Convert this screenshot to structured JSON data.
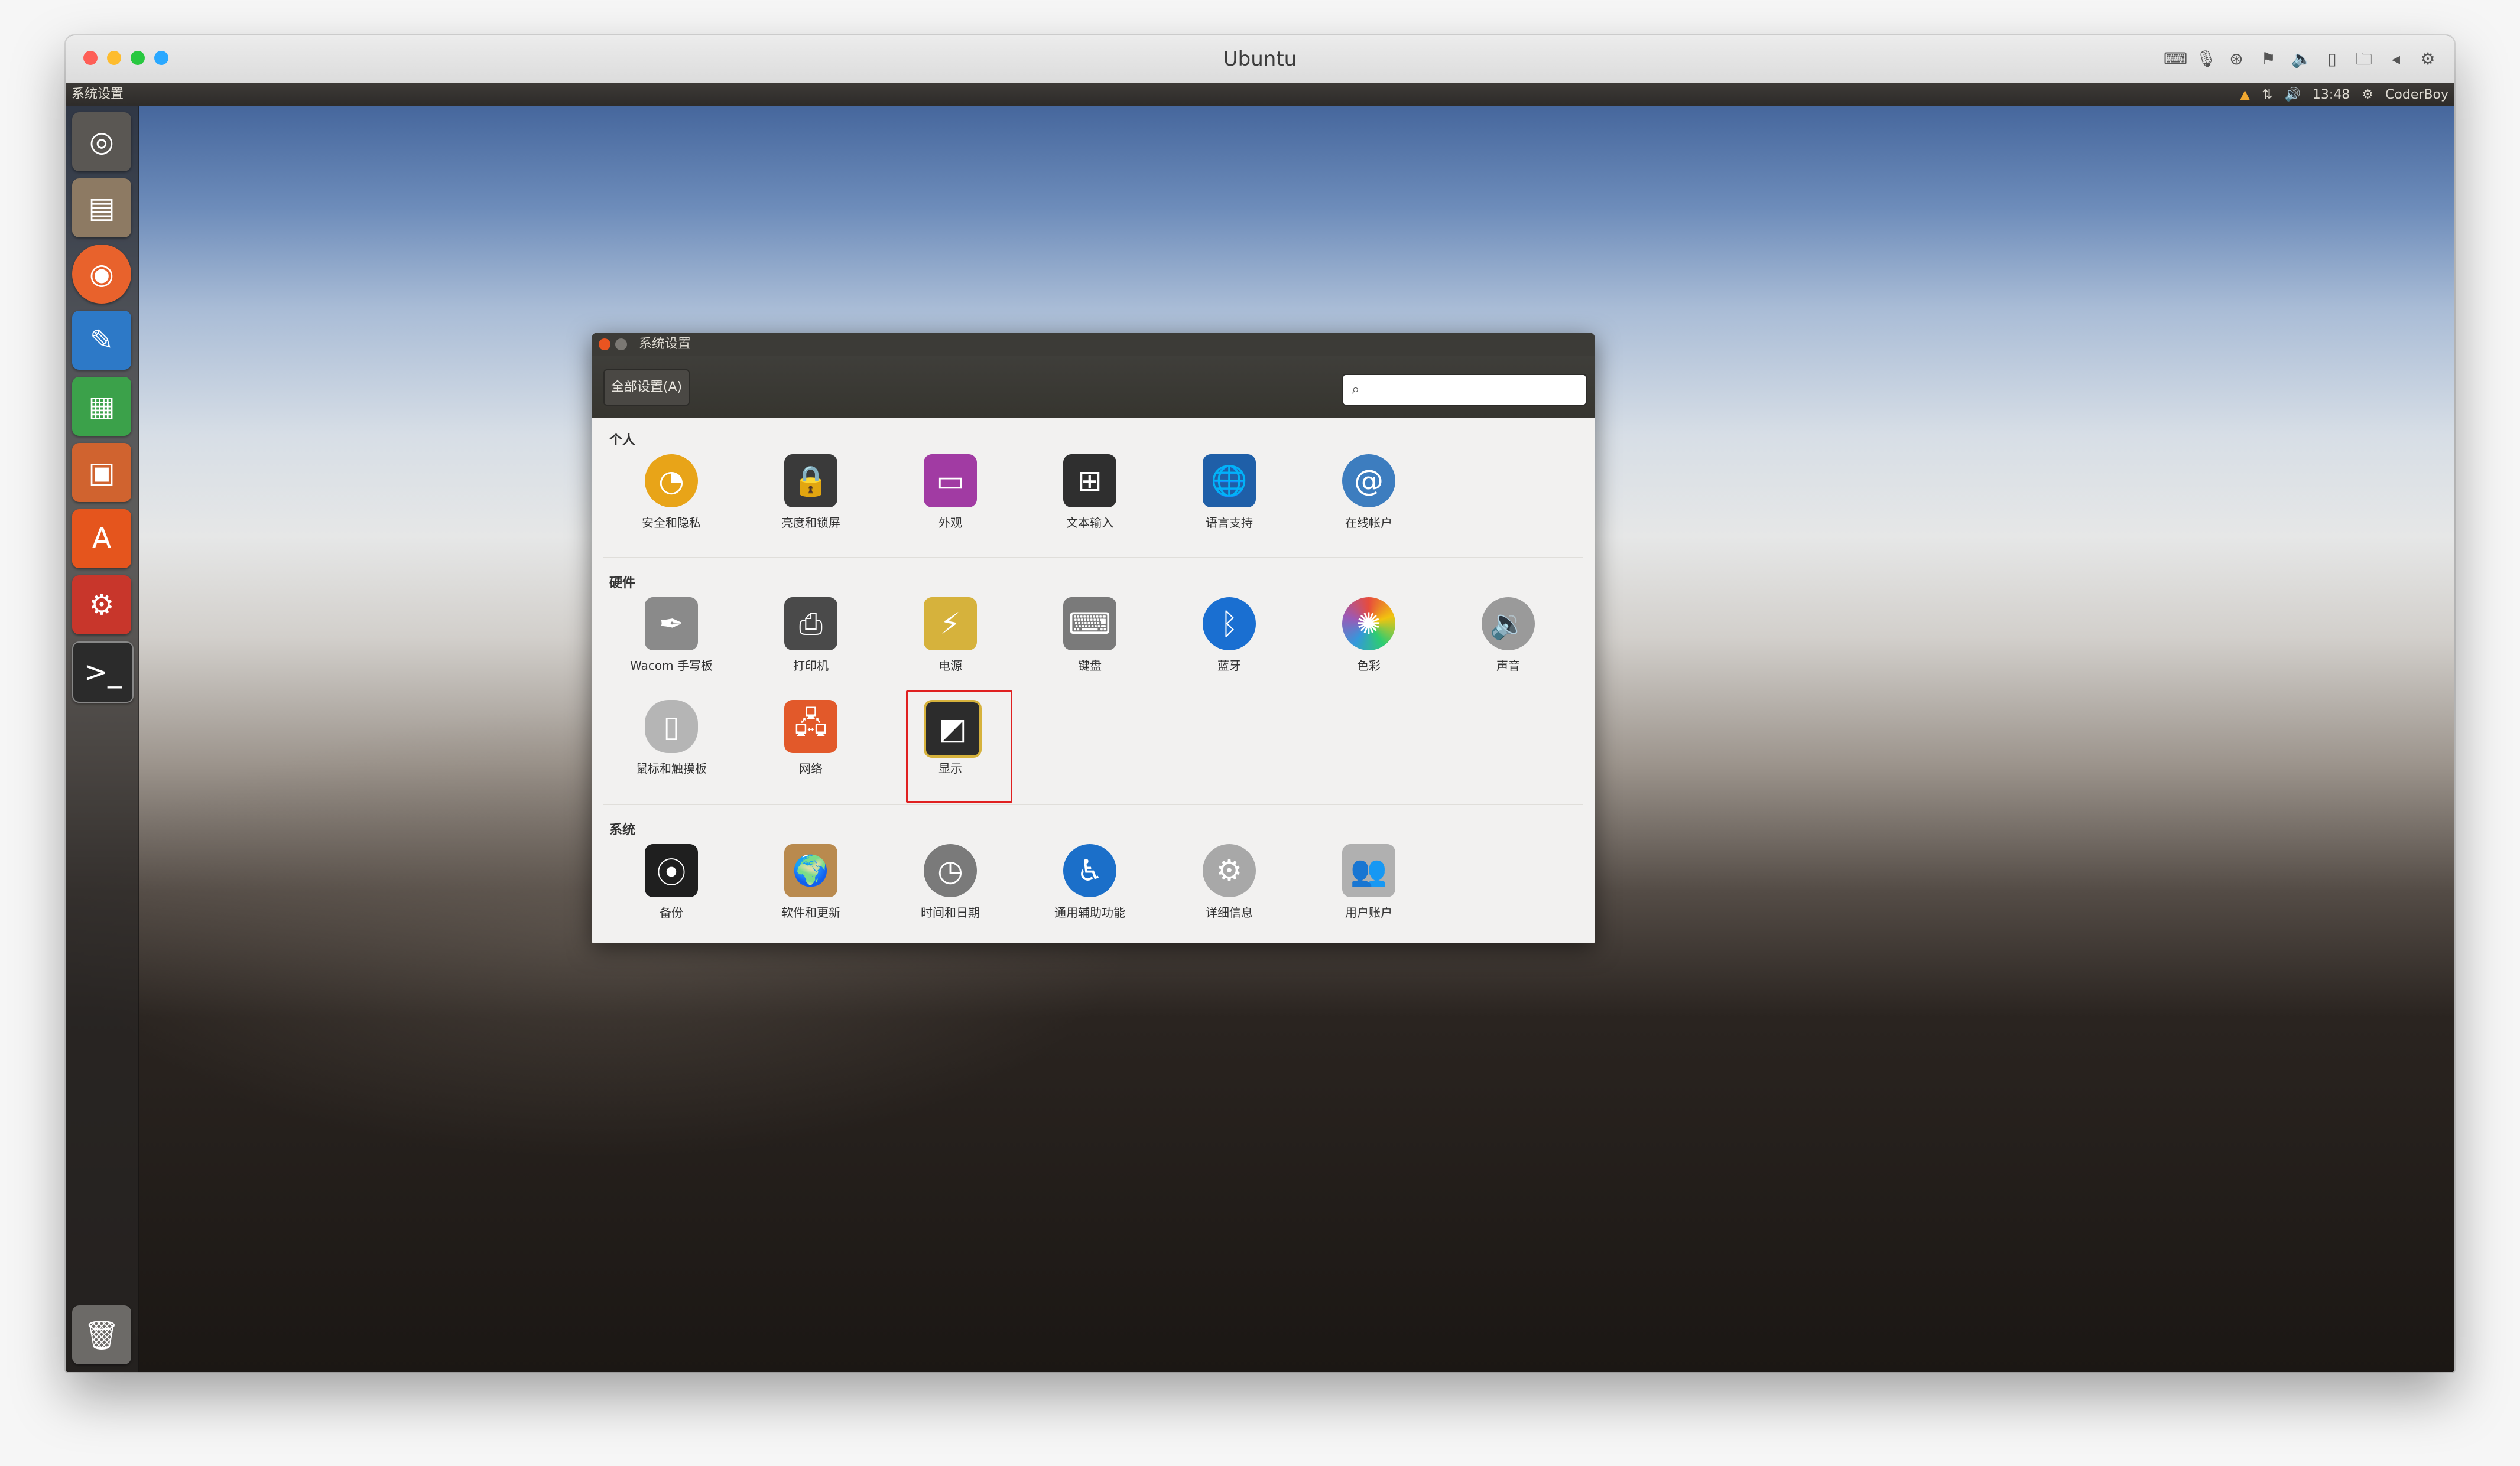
{
  "mac_window": {
    "title": "Ubuntu",
    "traffic_colors": [
      "#fe5f57",
      "#febc2e",
      "#28c840",
      "#2aa8ff"
    ],
    "toolbar_icons": [
      "keyboard-icon",
      "microphone-icon",
      "usb-icon",
      "flag-icon",
      "speaker-icon",
      "tablet-icon",
      "folder-icon",
      "back-icon",
      "gear-icon"
    ]
  },
  "ubuntu_panel": {
    "app_name": "系统设置",
    "indicators": {
      "time": "13:48",
      "user": "CoderBoy"
    }
  },
  "launcher": {
    "items": [
      "ubuntu-logo-icon",
      "files-icon",
      "firefox-icon",
      "writer-icon",
      "calc-icon",
      "impress-icon",
      "software-center-icon",
      "system-settings-icon",
      "terminal-icon"
    ],
    "trash": "trash-icon"
  },
  "settings_window": {
    "title": "系统设置",
    "all_settings_label": "全部设置(A)",
    "search_placeholder": "",
    "sections": [
      {
        "heading": "个人",
        "items": [
          {
            "label": "安全和隐私",
            "icon": "security-privacy-icon",
            "color": "#e8a418"
          },
          {
            "label": "亮度和锁屏",
            "icon": "brightness-lock-icon",
            "color": "#3a3a3a"
          },
          {
            "label": "外观",
            "icon": "appearance-icon",
            "color": "#a13ba3"
          },
          {
            "label": "文本输入",
            "icon": "text-entry-icon",
            "color": "#2f2f2f"
          },
          {
            "label": "语言支持",
            "icon": "language-support-icon",
            "color": "#1f5fa8"
          },
          {
            "label": "在线帐户",
            "icon": "online-accounts-icon",
            "color": "#3d7dbf"
          }
        ]
      },
      {
        "heading": "硬件",
        "items": [
          {
            "label": "Wacom 手写板",
            "icon": "wacom-tablet-icon",
            "color": "#8a8a8a"
          },
          {
            "label": "打印机",
            "icon": "printer-icon",
            "color": "#4a4a4a"
          },
          {
            "label": "电源",
            "icon": "power-icon",
            "color": "#d6b23c"
          },
          {
            "label": "键盘",
            "icon": "keyboard-icon",
            "color": "#7a7a7a"
          },
          {
            "label": "蓝牙",
            "icon": "bluetooth-icon",
            "color": "#1a6fd1"
          },
          {
            "label": "色彩",
            "icon": "color-icon",
            "color": "#e74c3c"
          },
          {
            "label": "声音",
            "icon": "sound-icon",
            "color": "#9a9a9a"
          },
          {
            "label": "鼠标和触摸板",
            "icon": "mouse-touchpad-icon",
            "color": "#b5b5b5"
          },
          {
            "label": "网络",
            "icon": "network-icon",
            "color": "#e2592a"
          },
          {
            "label": "显示",
            "icon": "display-icon",
            "color": "#2c2c2c"
          }
        ]
      },
      {
        "heading": "系统",
        "items": [
          {
            "label": "备份",
            "icon": "backup-icon",
            "color": "#1f1f1f"
          },
          {
            "label": "软件和更新",
            "icon": "software-updates-icon",
            "color": "#b98a4e"
          },
          {
            "label": "时间和日期",
            "icon": "time-date-icon",
            "color": "#7a7a7a"
          },
          {
            "label": "通用辅助功能",
            "icon": "universal-access-icon",
            "color": "#1b6fc9"
          },
          {
            "label": "详细信息",
            "icon": "details-icon",
            "color": "#a8a8a8"
          },
          {
            "label": "用户账户",
            "icon": "user-accounts-icon",
            "color": "#b0b0b0"
          }
        ]
      }
    ],
    "highlight_color": "#e02020"
  }
}
